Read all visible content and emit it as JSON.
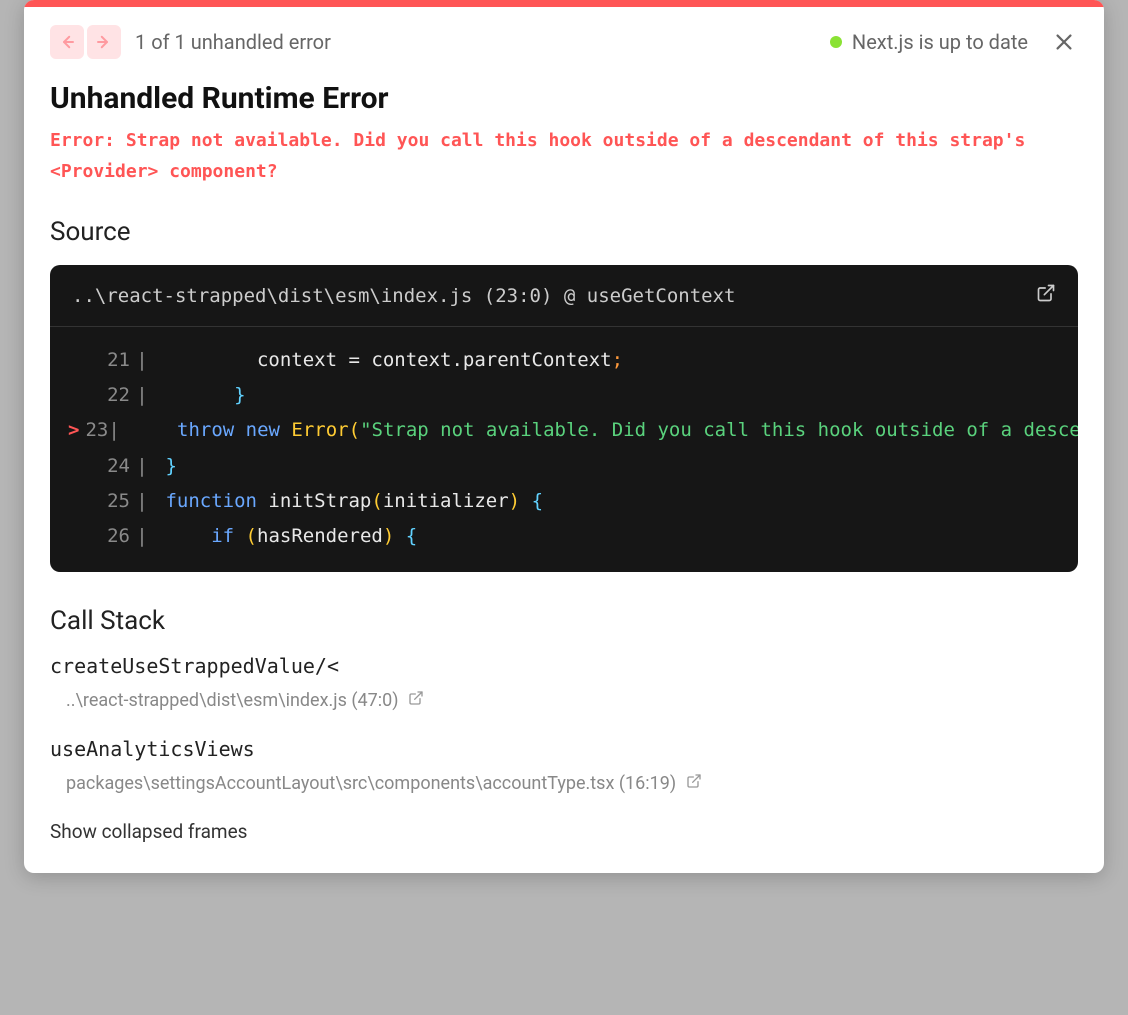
{
  "header": {
    "counter": "1 of 1 unhandled error",
    "status_text": "Next.js is up to date"
  },
  "error": {
    "title": "Unhandled Runtime Error",
    "message": "Error: Strap not available. Did you call this hook outside of a descendant of this strap's <Provider> component?"
  },
  "source": {
    "heading": "Source",
    "file_location": "..\\react-strapped\\dist\\esm\\index.js (23:0) @ useGetContext",
    "lines": [
      {
        "mark": "",
        "num": "21",
        "tokens": [
          {
            "t": "        ",
            "c": "tk-id"
          },
          {
            "t": "context ",
            "c": "tk-id"
          },
          {
            "t": "= ",
            "c": "tk-op"
          },
          {
            "t": "context",
            "c": "tk-id"
          },
          {
            "t": ".",
            "c": "tk-punct"
          },
          {
            "t": "parentContext",
            "c": "tk-id"
          },
          {
            "t": ";",
            "c": "tk-semi"
          }
        ]
      },
      {
        "mark": "",
        "num": "22",
        "tokens": [
          {
            "t": "      ",
            "c": "tk-id"
          },
          {
            "t": "}",
            "c": "tk-brace"
          }
        ]
      },
      {
        "mark": ">",
        "num": "23",
        "tokens": [
          {
            "t": "    ",
            "c": "tk-id"
          },
          {
            "t": "throw ",
            "c": "tk-kw"
          },
          {
            "t": "new ",
            "c": "tk-new"
          },
          {
            "t": "Error",
            "c": "tk-err"
          },
          {
            "t": "(",
            "c": "tk-paren"
          },
          {
            "t": "\"Strap not available. Did you call this hook outside of a descendant of this strap's <Provider> component?\"",
            "c": "tk-str"
          },
          {
            "t": ")",
            "c": "tk-paren"
          },
          {
            "t": ";",
            "c": "tk-semi"
          }
        ]
      },
      {
        "mark": "",
        "num": "24",
        "tokens": [
          {
            "t": "}",
            "c": "tk-brace"
          }
        ]
      },
      {
        "mark": "",
        "num": "25",
        "tokens": [
          {
            "t": "function ",
            "c": "tk-kwfn"
          },
          {
            "t": "initStrap",
            "c": "tk-id"
          },
          {
            "t": "(",
            "c": "tk-paren"
          },
          {
            "t": "initializer",
            "c": "tk-id"
          },
          {
            "t": ")",
            "c": "tk-paren"
          },
          {
            "t": " ",
            "c": "tk-id"
          },
          {
            "t": "{",
            "c": "tk-brace"
          }
        ]
      },
      {
        "mark": "",
        "num": "26",
        "tokens": [
          {
            "t": "    ",
            "c": "tk-id"
          },
          {
            "t": "if ",
            "c": "tk-kw"
          },
          {
            "t": "(",
            "c": "tk-paren"
          },
          {
            "t": "hasRendered",
            "c": "tk-id"
          },
          {
            "t": ")",
            "c": "tk-paren"
          },
          {
            "t": " ",
            "c": "tk-id"
          },
          {
            "t": "{",
            "c": "tk-brace"
          }
        ]
      }
    ]
  },
  "callstack": {
    "heading": "Call Stack",
    "frames": [
      {
        "fn": "createUseStrappedValue/<",
        "loc": "..\\react-strapped\\dist\\esm\\index.js (47:0)"
      },
      {
        "fn": "useAnalyticsViews",
        "loc": "packages\\settingsAccountLayout\\src\\components\\accountType.tsx (16:19)"
      }
    ],
    "show_collapsed": "Show collapsed frames"
  }
}
